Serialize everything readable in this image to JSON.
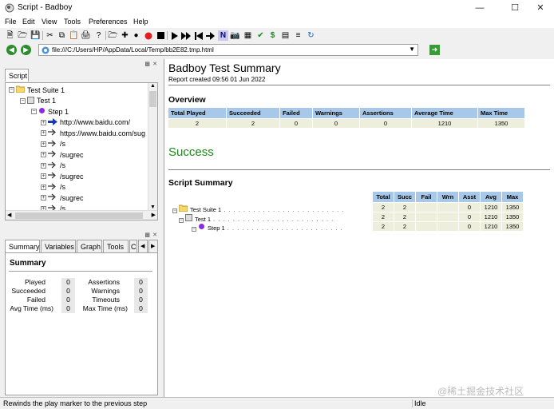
{
  "window": {
    "title": "Script - Badboy"
  },
  "menu": [
    "File",
    "Edit",
    "View",
    "Tools",
    "Preferences",
    "Help"
  ],
  "address": {
    "url": "file:///C:/Users/HP/AppData/Local/Temp/bb2E82.tmp.html"
  },
  "script_panel": {
    "tab": "Script",
    "tree": [
      {
        "label": "Test Suite 1"
      },
      {
        "label": "Test 1"
      },
      {
        "label": "Step 1"
      },
      {
        "label": "http://www.baidu.com/"
      },
      {
        "label": "https://www.baidu.com/sug"
      },
      {
        "label": "/s"
      },
      {
        "label": "/sugrec"
      },
      {
        "label": "/s"
      },
      {
        "label": "/sugrec"
      },
      {
        "label": "/s"
      },
      {
        "label": "/sugrec"
      },
      {
        "label": "/s"
      }
    ]
  },
  "summary_panel": {
    "tabs": [
      "Summary",
      "Variables",
      "Graph",
      "Tools",
      "C"
    ],
    "heading": "Summary",
    "left": [
      {
        "label": "Played",
        "value": "0"
      },
      {
        "label": "Succeeded",
        "value": "0"
      },
      {
        "label": "Failed",
        "value": "0"
      },
      {
        "label": "Avg Time (ms)",
        "value": "0"
      }
    ],
    "right": [
      {
        "label": "Assertions",
        "value": "0"
      },
      {
        "label": "Warnings",
        "value": "0"
      },
      {
        "label": "Timeouts",
        "value": "0"
      },
      {
        "label": "Max Time (ms)",
        "value": "0"
      }
    ]
  },
  "report": {
    "title": "Badboy Test Summary",
    "created": "Report created 09:56 01 Jun 2022",
    "overview_heading": "Overview",
    "overview_headers": [
      "Total Played",
      "Succeeded",
      "Failed",
      "Warnings",
      "Assertions",
      "Average Time",
      "Max Time"
    ],
    "overview_values": [
      "2",
      "2",
      "0",
      "0",
      "0",
      "1210",
      "1350"
    ],
    "result": "Success",
    "script_summary_heading": "Script Summary",
    "ss_headers": [
      "Total",
      "Succ",
      "Fail",
      "Wrn",
      "Asst",
      "Avg",
      "Max"
    ],
    "ss_rows": [
      {
        "name": "Test Suite 1",
        "cells": [
          "2",
          "2",
          "",
          "",
          "0",
          "1210",
          "1350"
        ]
      },
      {
        "name": "Test 1",
        "cells": [
          "2",
          "2",
          "",
          "",
          "0",
          "1210",
          "1350"
        ]
      },
      {
        "name": "Step 1",
        "cells": [
          "2",
          "2",
          "",
          "",
          "0",
          "1210",
          "1350"
        ]
      }
    ]
  },
  "status": {
    "message": "Rewinds the play marker to the previous step",
    "state": "Idle"
  },
  "watermark": "@稀土掘金技术社区"
}
